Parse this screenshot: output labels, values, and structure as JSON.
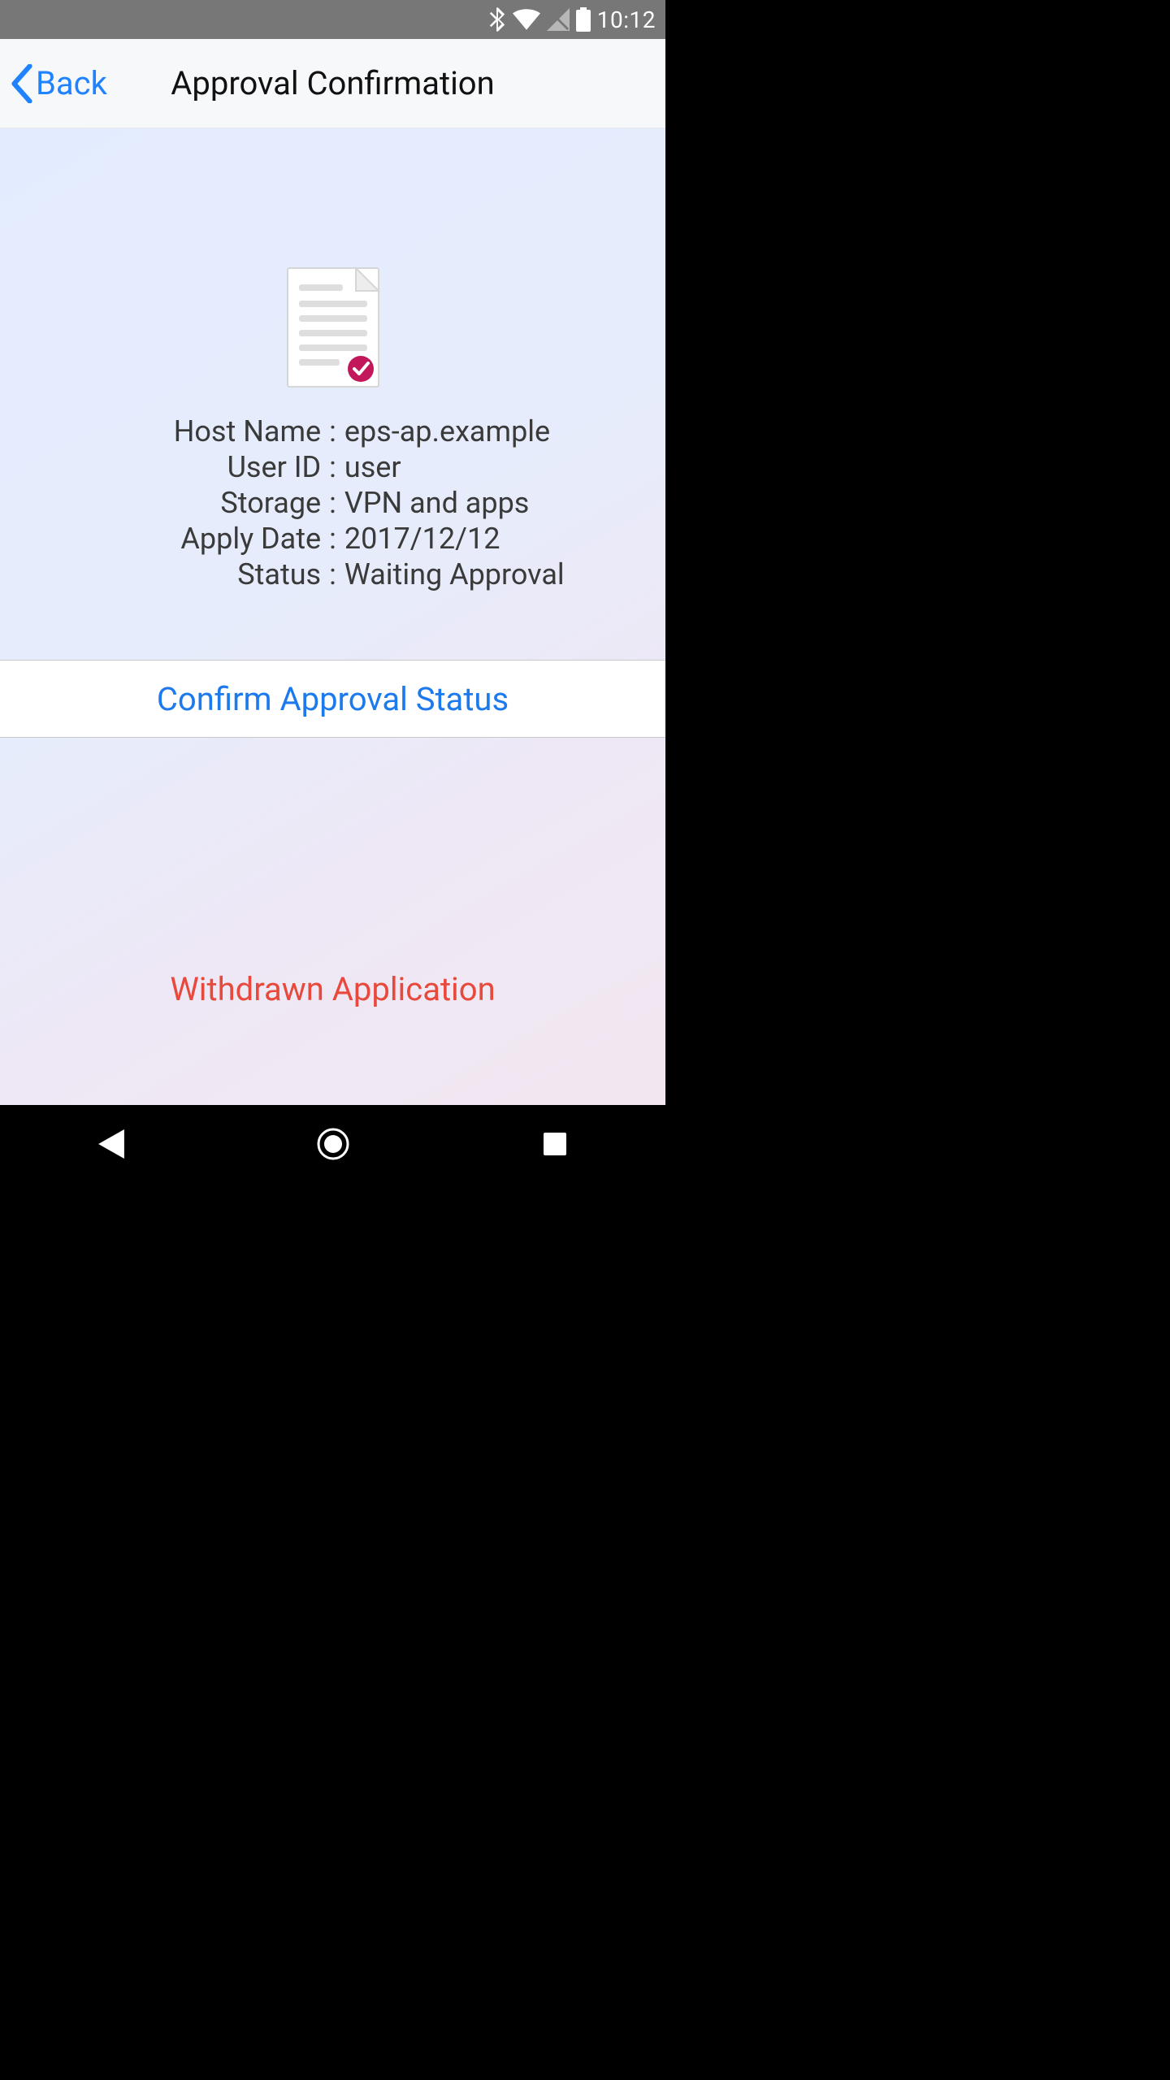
{
  "status_bar": {
    "time": "10:12"
  },
  "header": {
    "back_label": "Back",
    "title": "Approval Confirmation"
  },
  "details": {
    "rows": [
      {
        "label": "Host Name",
        "value": "eps-ap.example"
      },
      {
        "label": "User ID",
        "value": "user"
      },
      {
        "label": "Storage",
        "value": "VPN and apps"
      },
      {
        "label": "Apply Date",
        "value": "2017/12/12"
      },
      {
        "label": "Status",
        "value": "Waiting Approval"
      }
    ]
  },
  "actions": {
    "confirm_label": "Confirm Approval Status",
    "withdraw_label": "Withdrawn Application"
  },
  "icons": {
    "document_check": "document-check-icon",
    "bluetooth": "bluetooth-icon",
    "wifi": "wifi-icon",
    "sim_disabled": "sim-disabled-icon",
    "battery": "battery-icon"
  }
}
